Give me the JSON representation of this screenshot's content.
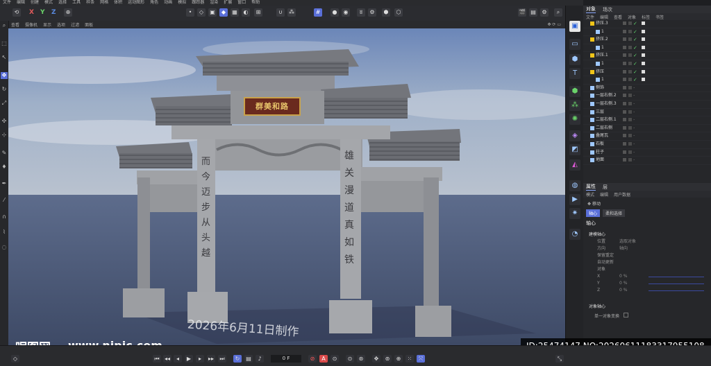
{
  "menu": [
    "文件",
    "编辑",
    "创建",
    "模式",
    "选择",
    "工具",
    "样条",
    "网格",
    "体积",
    "运动图形",
    "角色",
    "动画",
    "模拟",
    "跟踪器",
    "渲染",
    "扩展",
    "窗口",
    "帮助"
  ],
  "axes": {
    "x": "X",
    "y": "Y",
    "z": "Z"
  },
  "view_menu": [
    "查看",
    "摄像机",
    "显示",
    "选项",
    "过滤",
    "面板"
  ],
  "objects_panel": {
    "tabs": [
      "对象",
      "场次"
    ],
    "menu": [
      "文件",
      "编辑",
      "查看",
      "对象",
      "标签",
      "书签"
    ],
    "items": [
      {
        "name": "挤压.3",
        "color": "#f0c419",
        "tick": true
      },
      {
        "name": "1",
        "color": "#9fc8ff",
        "tick": true
      },
      {
        "name": "挤压.2",
        "color": "#f0c419",
        "tick": true
      },
      {
        "name": "1",
        "color": "#9fc8ff",
        "tick": true
      },
      {
        "name": "挤压.1",
        "color": "#f0c419",
        "tick": true
      },
      {
        "name": "1",
        "color": "#9fc8ff",
        "tick": true
      },
      {
        "name": "挤压",
        "color": "#f0c419",
        "tick": true
      },
      {
        "name": "1",
        "color": "#9fc8ff",
        "tick": true
      },
      {
        "name": "侧饰",
        "color": "#9fc8ff",
        "tick": false
      },
      {
        "name": "一层右侧.2",
        "color": "#9fc8ff",
        "tick": false
      },
      {
        "name": "一层右侧.3",
        "color": "#9fc8ff",
        "tick": false
      },
      {
        "name": "三层",
        "color": "#9fc8ff",
        "tick": false
      },
      {
        "name": "二层右侧.1",
        "color": "#9fc8ff",
        "tick": false
      },
      {
        "name": "二层右侧",
        "color": "#9fc8ff",
        "tick": false
      },
      {
        "name": "叠尾瓦",
        "color": "#9fc8ff",
        "tick": false
      },
      {
        "name": "石板",
        "color": "#9fc8ff",
        "tick": false
      },
      {
        "name": "柱子",
        "color": "#9fc8ff",
        "tick": false
      },
      {
        "name": "地面",
        "color": "#9fc8ff",
        "tick": false
      }
    ]
  },
  "attributes_panel": {
    "tabs": [
      "属性",
      "层"
    ],
    "menu": [
      "模式",
      "编辑",
      "用户数据"
    ],
    "tool": "移动",
    "subtabs": [
      "轴心",
      "柔和选择"
    ],
    "section": "轴心",
    "group1": "建模轴心",
    "fields": [
      {
        "label": "位置",
        "value": "选取对象"
      },
      {
        "label": "方向",
        "value": "轴向"
      },
      {
        "label": "保留重定",
        "value": ""
      },
      {
        "label": "自动更新",
        "value": ""
      },
      {
        "label": "对象",
        "value": ""
      },
      {
        "label": "X",
        "value": "0 %"
      },
      {
        "label": "Y",
        "value": "0 %"
      },
      {
        "label": "Z",
        "value": "0 %"
      }
    ],
    "group2": "对象轴心",
    "single_object": "单一对象变换"
  },
  "scene": {
    "plaque": "群美和路",
    "left_couplet": "而今迈步从头越",
    "right_couplet": "雄关漫道真如铁",
    "date_text": "2026年6月11日制作"
  },
  "watermark": {
    "logo": "昵图网",
    "url": "www.nipic.com",
    "id_text": "ID:25474147 NO:20260611183317955108"
  },
  "timeline": {
    "frame": "0 F"
  },
  "colors": {
    "accent": "#5a6fd8",
    "sky_top": "#7790c0",
    "ground": "#4c5a78"
  }
}
